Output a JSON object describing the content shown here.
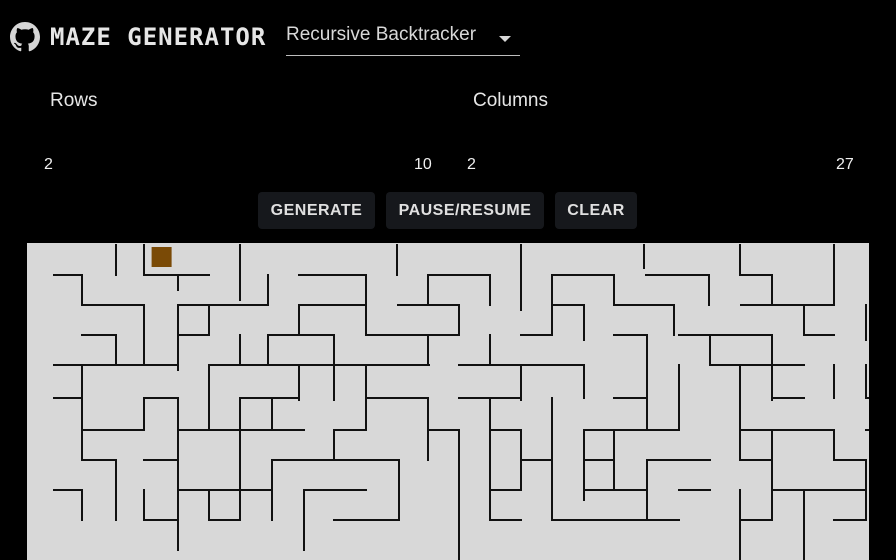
{
  "header": {
    "title": "MAZE GENERATOR",
    "algorithm_selected": "Recursive Backtracker",
    "github_icon": "github-icon",
    "dropdown_icon": "chevron-down-icon"
  },
  "controls": {
    "rows": {
      "label": "Rows",
      "min": "2",
      "max": "10"
    },
    "columns": {
      "label": "Columns",
      "min": "2",
      "max": "27"
    }
  },
  "buttons": {
    "generate": "GENERATE",
    "pause_resume": "PAUSE/RESUME",
    "clear": "CLEAR"
  },
  "maze": {
    "background": "#d8d8d8",
    "wall_color": "#111111",
    "cursor_color": "#7a4a06",
    "cursor_cell": {
      "row": 0,
      "col": 3
    },
    "walls": [
      "M62 245 V275",
      "M90 245 V275",
      "M186 245 V300",
      "M343 245 V275",
      "M467 245 V310",
      "M590 245 V268",
      "M686 245 V275",
      "M780 245 V275",
      "M0 275 H28",
      "M90 275 H155",
      "M245 275 H310",
      "M375 275 H435",
      "M500 275 H560",
      "M592 275 H655",
      "M686 275 H718",
      "M28 275 V305",
      "M124 275 V290",
      "M214 275 V305",
      "M312 275 V305",
      "M374 275 V305",
      "M436 275 V305",
      "M498 275 V335",
      "M560 275 V305",
      "M655 275 V305",
      "M718 275 V305",
      "M780 275 V305",
      "M28 305 H90",
      "M124 305 H214",
      "M245 305 H312",
      "M344 305 H405",
      "M498 305 H530",
      "M560 305 H620",
      "M687 305 H780",
      "M124 305 V370",
      "M90 305 V335",
      "M155 305 V335",
      "M245 305 V335",
      "M312 305 V335",
      "M405 305 V335",
      "M530 305 V340",
      "M620 305 V335",
      "M750 305 V335",
      "M812 305 V340",
      "M28 335 H62",
      "M124 335 H155",
      "M214 335 H280",
      "M312 335 H405",
      "M467 335 H498",
      "M560 335 H593",
      "M625 335 H718",
      "M750 335 H780",
      "M62 335 V365",
      "M90 335 V365",
      "M186 335 V365",
      "M214 335 V365",
      "M280 335 V400",
      "M374 335 V365",
      "M436 335 V365",
      "M593 335 V430",
      "M656 335 V365",
      "M718 335 V400",
      "M0 365 H62",
      "M62 365 H124",
      "M155 365 H250",
      "M250 365 H375",
      "M405 365 H530",
      "M656 365 H718",
      "M718 365 H750",
      "M28 365 V400",
      "M155 365 V430",
      "M245 365 V400",
      "M312 365 V400",
      "M467 365 V400",
      "M530 365 V398",
      "M625 365 V398",
      "M686 365 V430",
      "M780 365 V398",
      "M812 365 V398",
      "M0 398 H28",
      "M90 398 H124",
      "M186 398 H245",
      "M312 398 H374",
      "M405 398 H467",
      "M560 398 H593",
      "M718 398 H750",
      "M812 398 H842",
      "M28 398 V460",
      "M90 398 V430",
      "M124 398 V460",
      "M186 398 V430",
      "M218 398 V430",
      "M312 398 V430",
      "M374 398 V460",
      "M436 398 V460",
      "M498 398 V460",
      "M625 398 V430",
      "M686 398 V460",
      "M28 430 H90",
      "M124 430 H155",
      "M155 430 H218",
      "M218 430 H250",
      "M280 430 H312",
      "M374 430 H405",
      "M436 430 H467",
      "M530 430 H625",
      "M686 430 H780",
      "M812 430 H842",
      "M186 430 V460",
      "M280 430 V460",
      "M405 430 V520",
      "M467 430 V490",
      "M530 430 V500",
      "M560 430 V490",
      "M718 430 V460",
      "M780 430 V460",
      "M28 460 H62",
      "M90 460 H124",
      "M218 460 H345",
      "M467 460 H498",
      "M530 460 H560",
      "M593 460 H656",
      "M686 460 H718",
      "M780 460 H812",
      "M62 460 V490",
      "M124 460 V520",
      "M186 460 V520",
      "M218 460 V490",
      "M345 460 V520",
      "M436 460 V490",
      "M498 460 V520",
      "M593 460 V490",
      "M718 460 V520",
      "M812 460 V520",
      "M0 490 H28",
      "M124 490 H186",
      "M186 490 H218",
      "M250 490 H312",
      "M436 490 H467",
      "M530 490 H593",
      "M625 490 H656",
      "M718 490 H812",
      "M28 490 V520",
      "M62 490 V520",
      "M90 490 V520",
      "M124 490 V550",
      "M155 490 V520",
      "M218 490 V520",
      "M250 490 V550",
      "M436 490 V520",
      "M593 490 V520",
      "M686 490 V520",
      "M750 490 V520",
      "M90 520 H124",
      "M155 520 H186",
      "M280 520 H345",
      "M436 520 H467",
      "M498 520 H593",
      "M593 520 H625",
      "M686 520 H718",
      "M780 520 H812",
      "M405 520 V560",
      "M686 520 V560",
      "M750 520 V560"
    ]
  }
}
